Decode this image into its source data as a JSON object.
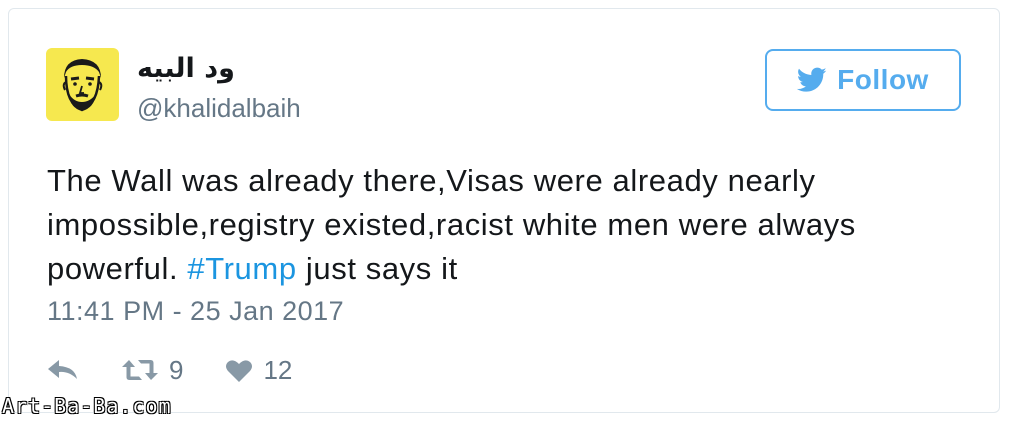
{
  "author": {
    "display_name": "ود البيه",
    "handle": "@khalidalbaih"
  },
  "follow_button": {
    "label": "Follow",
    "icon": "twitter-bird-icon"
  },
  "tweet": {
    "line1": "The Wall was already there,Visas were already nearly",
    "line2": "impossible,registry existed,racist white men were always",
    "line3_before": "powerful. ",
    "hashtag": "#Trump",
    "line3_after": " just says it",
    "timestamp": "11:41 PM - 25 Jan 2017"
  },
  "actions": {
    "reply_icon": "reply-icon",
    "retweet_icon": "retweet-icon",
    "retweet_count": "9",
    "like_icon": "heart-icon",
    "like_count": "12"
  },
  "watermark": "Art-Ba-Ba.com",
  "colors": {
    "accent": "#55acee",
    "hashtag": "#1b95e0",
    "secondary_text": "#657786",
    "avatar_bg": "#f6e84f"
  }
}
